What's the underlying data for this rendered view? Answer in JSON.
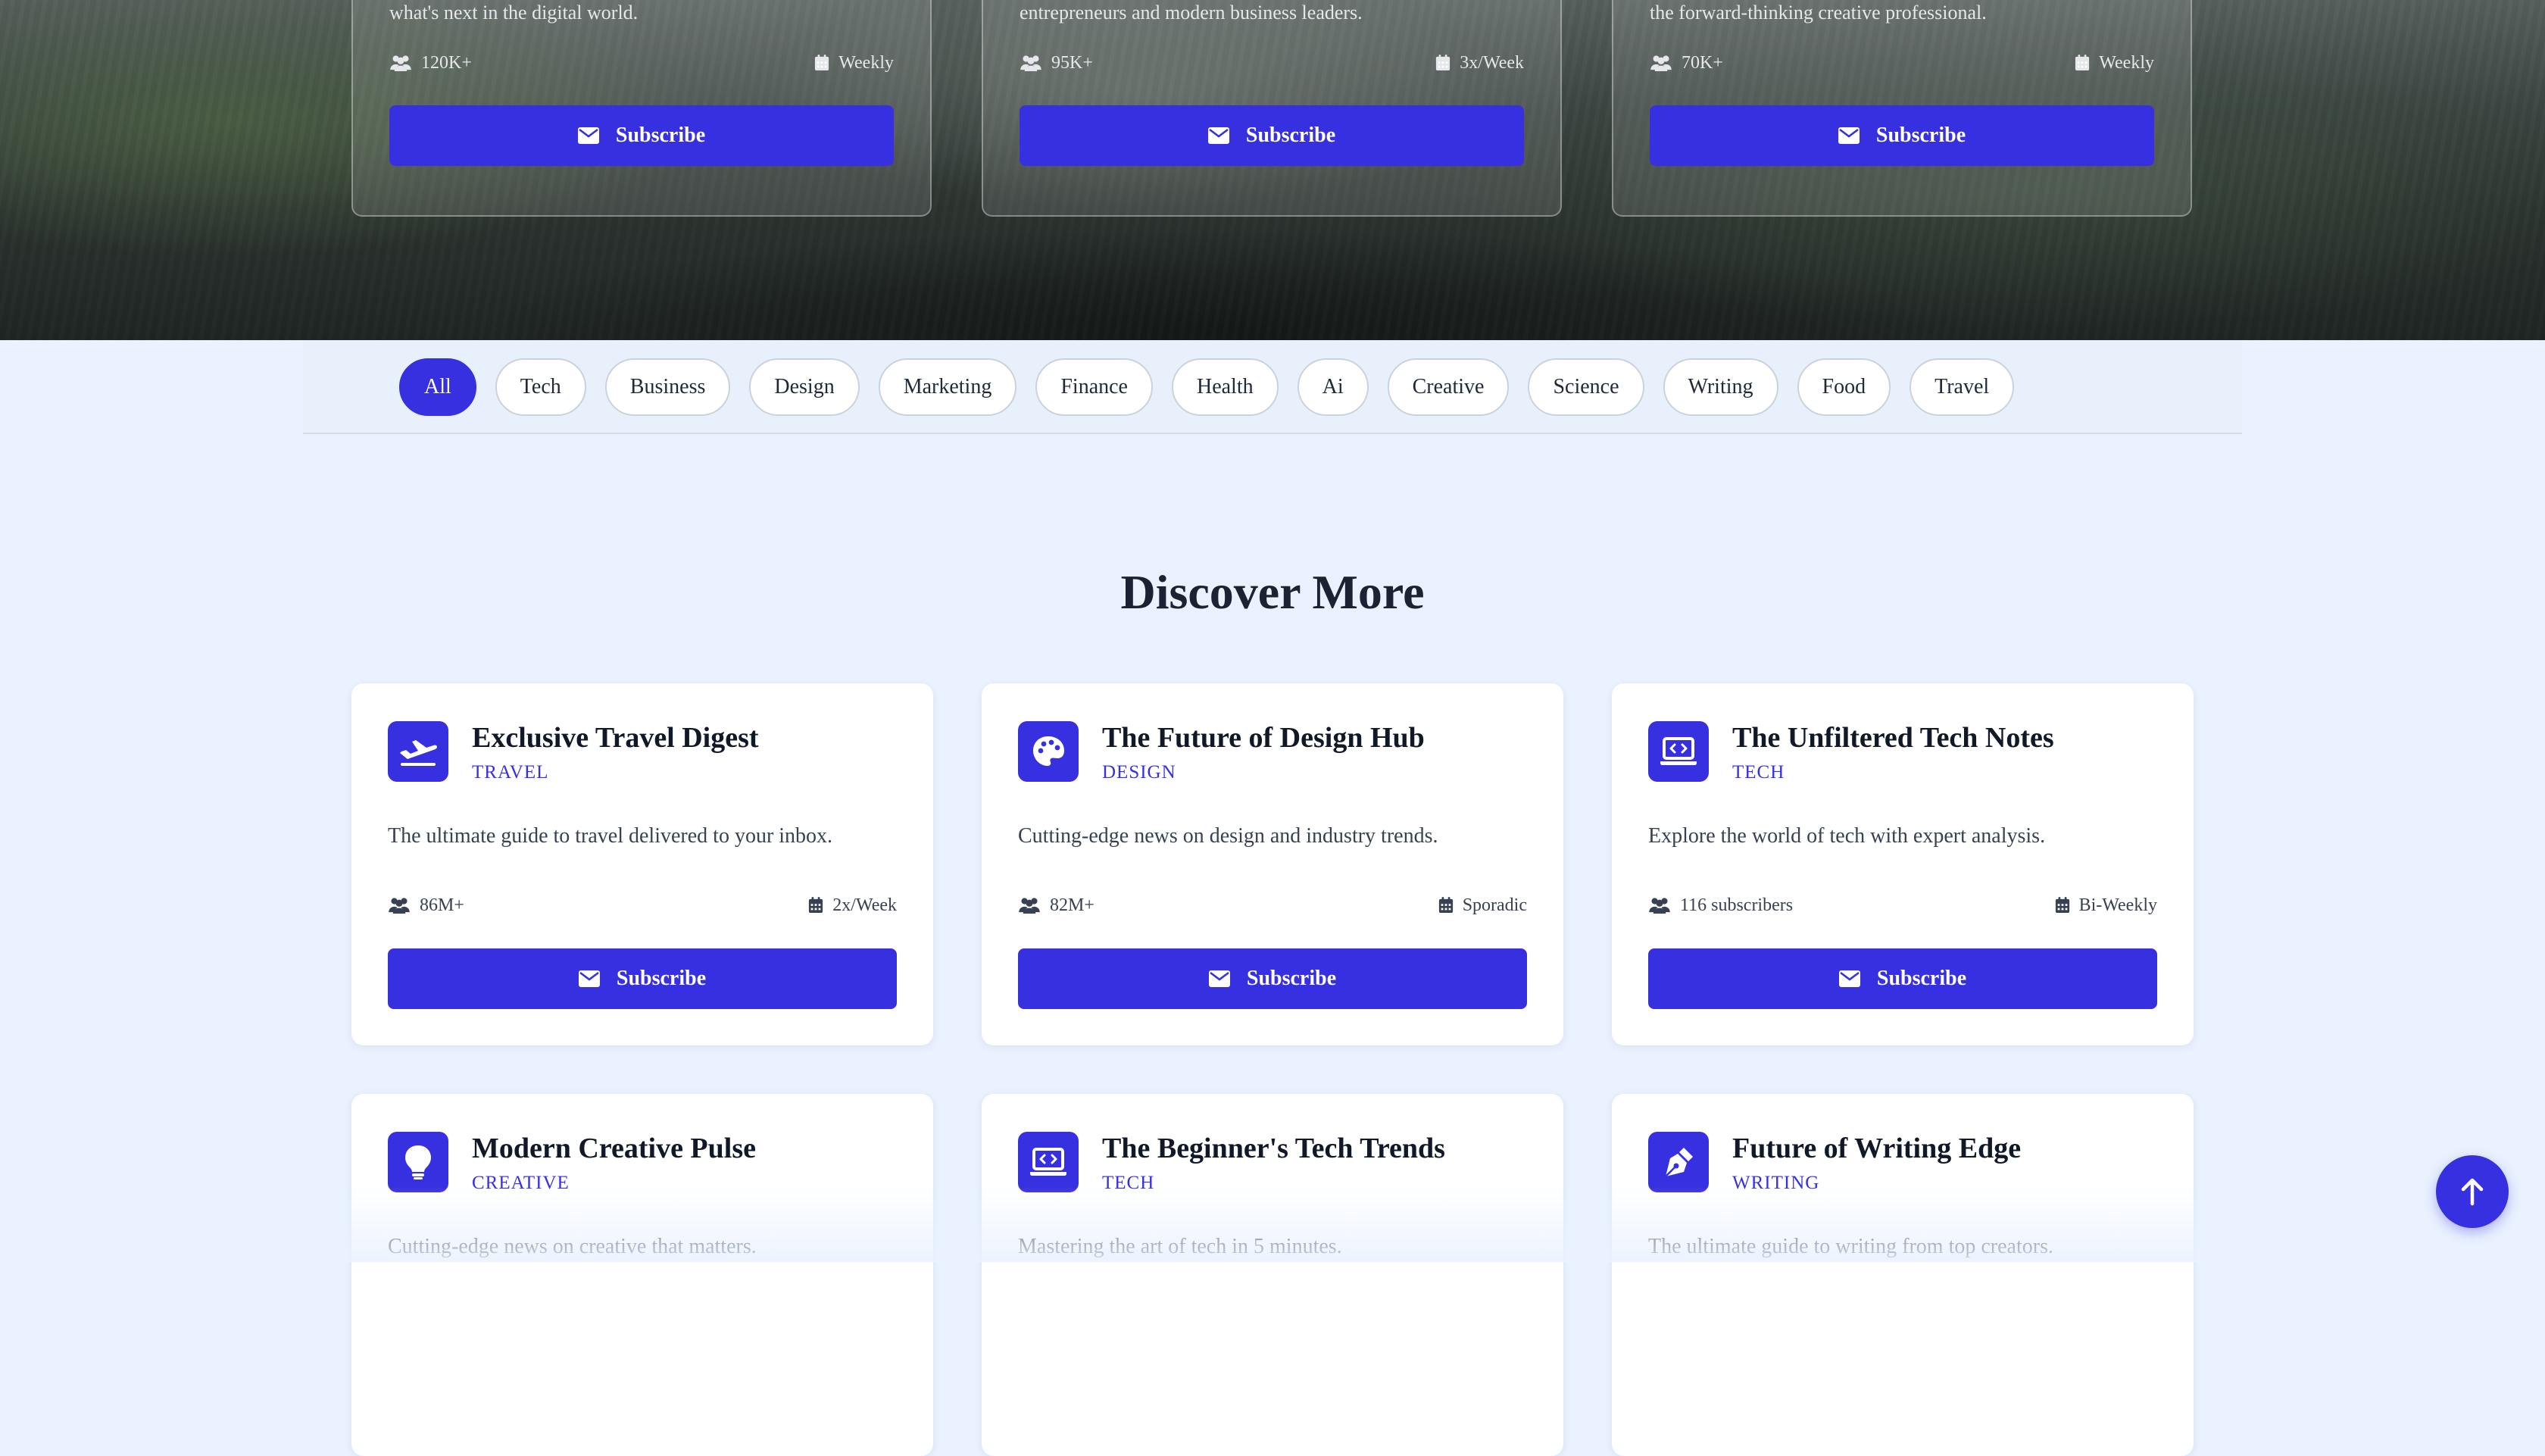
{
  "hero_cards": [
    {
      "desc": "what's next in the digital world.",
      "subscribers": "120K+",
      "frequency": "Weekly",
      "button": "Subscribe"
    },
    {
      "desc": "entrepreneurs and modern business leaders.",
      "subscribers": "95K+",
      "frequency": "3x/Week",
      "button": "Subscribe"
    },
    {
      "desc": "the forward-thinking creative professional.",
      "subscribers": "70K+",
      "frequency": "Weekly",
      "button": "Subscribe"
    }
  ],
  "filters": [
    "All",
    "Tech",
    "Business",
    "Design",
    "Marketing",
    "Finance",
    "Health",
    "Ai",
    "Creative",
    "Science",
    "Writing",
    "Food",
    "Travel"
  ],
  "active_filter": "All",
  "section": {
    "title": "Discover More"
  },
  "cards": [
    {
      "icon": "plane-departure-icon",
      "title": "Exclusive Travel Digest",
      "category": "TRAVEL",
      "desc": "The ultimate guide to travel delivered to your inbox.",
      "subscribers": "86M+",
      "frequency": "2x/Week",
      "button": "Subscribe"
    },
    {
      "icon": "palette-icon",
      "title": "The Future of Design Hub",
      "category": "DESIGN",
      "desc": "Cutting-edge news on design and industry trends.",
      "subscribers": "82M+",
      "frequency": "Sporadic",
      "button": "Subscribe"
    },
    {
      "icon": "laptop-code-icon",
      "title": "The Unfiltered Tech Notes",
      "category": "TECH",
      "desc": "Explore the world of tech with expert analysis.",
      "subscribers": "116 subscribers",
      "frequency": "Bi-Weekly",
      "button": "Subscribe"
    },
    {
      "icon": "lightbulb-icon",
      "title": "Modern Creative Pulse",
      "category": "CREATIVE",
      "desc": "Cutting-edge news on creative that matters."
    },
    {
      "icon": "laptop-code-icon",
      "title": "The Beginner's Tech Trends",
      "category": "TECH",
      "desc": "Mastering the art of tech in 5 minutes."
    },
    {
      "icon": "pen-nib-icon",
      "title": "Future of Writing Edge",
      "category": "WRITING",
      "desc": "The ultimate guide to writing from top creators."
    }
  ],
  "colors": {
    "accent": "#3730e0",
    "page_bg": "#eaf2ff",
    "card_bg": "#ffffff"
  }
}
